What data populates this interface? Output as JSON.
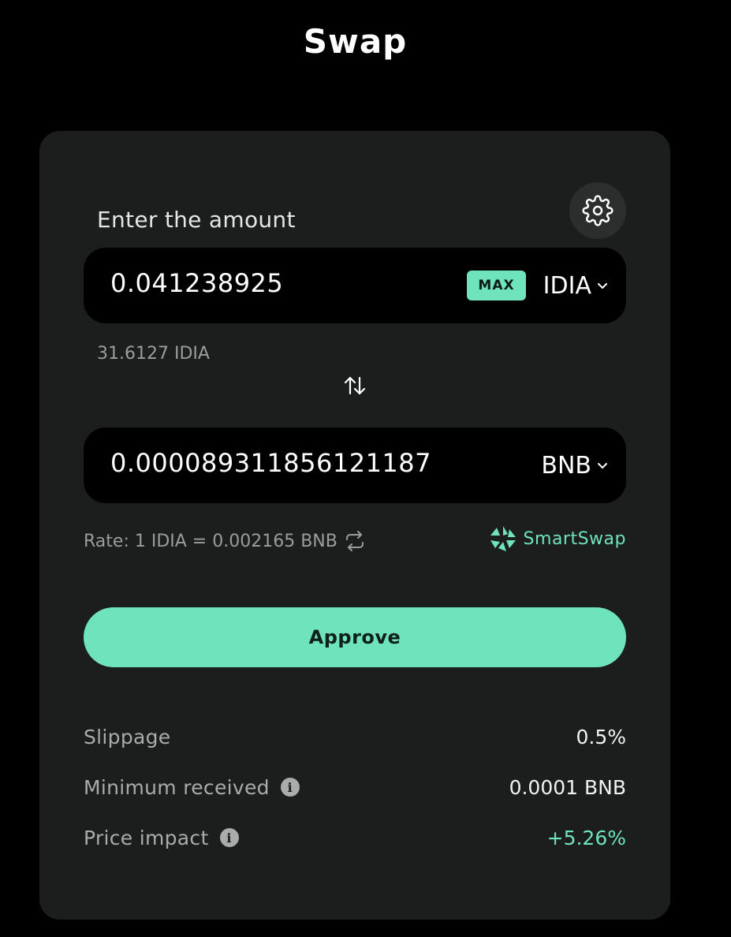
{
  "page": {
    "title": "Swap"
  },
  "form": {
    "enter_label": "Enter the amount",
    "from": {
      "amount": "0.041238925",
      "max_label": "MAX",
      "token": "IDIA",
      "balance": "31.6127 IDIA"
    },
    "to": {
      "amount": "0.000089311856121187",
      "token": "BNB"
    },
    "rate": "Rate: 1 IDIA = 0.002165 BNB",
    "brand": "SmartSwap",
    "approve_label": "Approve"
  },
  "details": {
    "slippage_label": "Slippage",
    "slippage_value": "0.5%",
    "min_received_label": "Minimum received",
    "min_received_value": "0.0001 BNB",
    "price_impact_label": "Price impact",
    "price_impact_value": "+5.26%"
  },
  "icons": {
    "settings": "gear-icon",
    "switch": "swap-arrows-icon",
    "refresh": "refresh-icon",
    "chevron": "chevron-down-icon",
    "info": "info-icon",
    "brand": "smartswap-logo"
  },
  "colors": {
    "accent": "#6fe3bb",
    "card": "#1c1e1e",
    "background": "#000000"
  }
}
